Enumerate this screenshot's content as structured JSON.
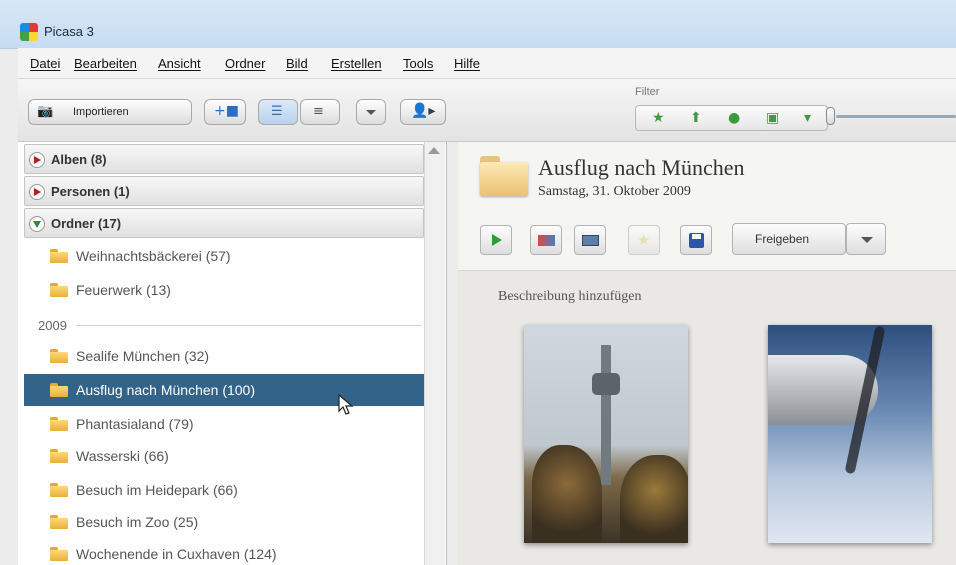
{
  "window": {
    "title": "Picasa 3"
  },
  "menu": [
    {
      "label": "Datei"
    },
    {
      "label": "Bearbeiten"
    },
    {
      "label": "Ansicht"
    },
    {
      "label": "Ordner"
    },
    {
      "label": "Bild"
    },
    {
      "label": "Erstellen"
    },
    {
      "label": "Tools"
    },
    {
      "label": "Hilfe"
    }
  ],
  "toolbar": {
    "import_label": "Importieren",
    "filter_label": "Filter",
    "filter_icons": [
      "star-icon",
      "upload-icon",
      "person-icon",
      "movie-icon",
      "geotag-icon"
    ]
  },
  "sidebar": {
    "sections": [
      {
        "label": "Alben (8)"
      },
      {
        "label": "Personen (1)"
      },
      {
        "label": "Ordner (17)"
      }
    ],
    "folders_before": [
      {
        "label": "Weihnachtsbäckerei (57)"
      },
      {
        "label": "Feuerwerk (13)"
      }
    ],
    "year": "2009",
    "folders": [
      {
        "label": "Sealife München (32)"
      },
      {
        "label": "Ausflug nach München (100)"
      },
      {
        "label": "Phantasialand (79)"
      },
      {
        "label": "Wasserski (66)"
      },
      {
        "label": "Besuch im Heidepark (66)"
      },
      {
        "label": "Besuch im Zoo (25)"
      },
      {
        "label": "Wochenende in Cuxhaven (124)"
      }
    ]
  },
  "album": {
    "title": "Ausflug nach München",
    "date": "Samstag, 31. Oktober 2009",
    "share_label": "Freigeben",
    "description_placeholder": "Beschreibung hinzufügen"
  },
  "colors": {
    "selection": "#346389",
    "play_green": "#2e9e3a"
  }
}
